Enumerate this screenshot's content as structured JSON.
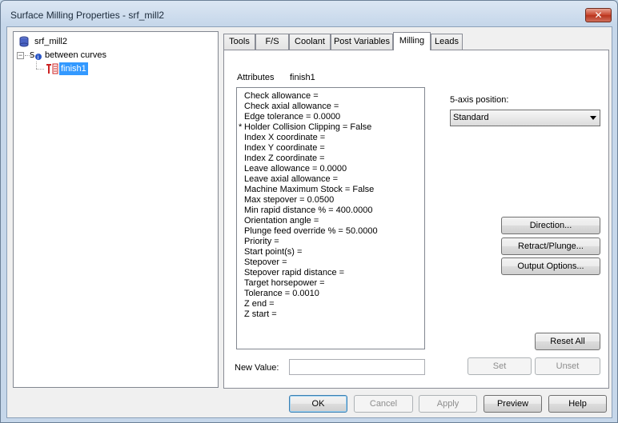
{
  "window": {
    "title": "Surface Milling Properties - srf_mill2",
    "close_glyph": "✕"
  },
  "tree": {
    "root": "srf_mill2",
    "group": "between curves",
    "leaf": "finish1",
    "expander_glyph": "−"
  },
  "tabs": [
    "Tools",
    "F/S",
    "Coolant",
    "Post Variables",
    "Milling",
    "Leads"
  ],
  "active_tab": "Milling",
  "attributes": {
    "caption": "Attributes",
    "operation": "finish1",
    "items": [
      {
        "marker": "",
        "text": "Check allowance ="
      },
      {
        "marker": "",
        "text": "Check axial allowance ="
      },
      {
        "marker": "",
        "text": "Edge tolerance = 0.0000"
      },
      {
        "marker": "*",
        "text": "Holder Collision Clipping = False"
      },
      {
        "marker": "",
        "text": "Index X coordinate ="
      },
      {
        "marker": "",
        "text": "Index Y coordinate ="
      },
      {
        "marker": "",
        "text": "Index Z coordinate ="
      },
      {
        "marker": "",
        "text": "Leave allowance = 0.0000"
      },
      {
        "marker": "",
        "text": "Leave axial allowance ="
      },
      {
        "marker": "",
        "text": "Machine Maximum Stock = False"
      },
      {
        "marker": "",
        "text": "Max stepover = 0.0500"
      },
      {
        "marker": "",
        "text": "Min rapid distance % = 400.0000"
      },
      {
        "marker": "",
        "text": "Orientation angle ="
      },
      {
        "marker": "",
        "text": "Plunge feed override % = 50.0000"
      },
      {
        "marker": "",
        "text": "Priority ="
      },
      {
        "marker": "",
        "text": "Start point(s) ="
      },
      {
        "marker": "",
        "text": "Stepover ="
      },
      {
        "marker": "",
        "text": "Stepover rapid distance ="
      },
      {
        "marker": "",
        "text": "Target horsepower ="
      },
      {
        "marker": "",
        "text": "Tolerance = 0.0010"
      },
      {
        "marker": "",
        "text": "Z end ="
      },
      {
        "marker": "",
        "text": "Z start ="
      }
    ]
  },
  "new_value": {
    "label": "New Value:",
    "value": ""
  },
  "five_axis": {
    "label": "5-axis position:",
    "selected": "Standard"
  },
  "buttons": {
    "direction": "Direction...",
    "retract": "Retract/Plunge...",
    "output": "Output Options...",
    "reset_all": "Reset All",
    "set": "Set",
    "unset": "Unset"
  },
  "footer": {
    "ok": "OK",
    "cancel": "Cancel",
    "apply": "Apply",
    "preview": "Preview",
    "help": "Help"
  }
}
